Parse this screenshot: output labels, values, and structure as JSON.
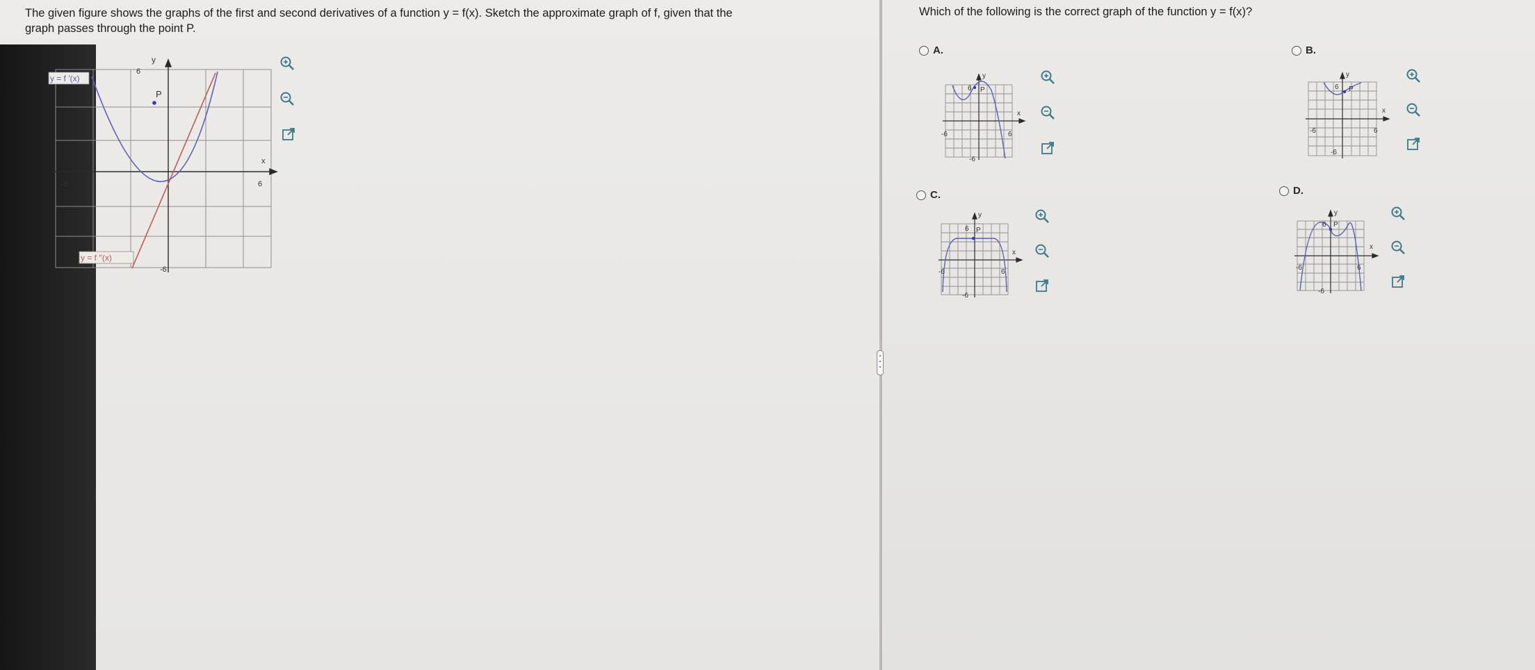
{
  "question": {
    "line1": "The given figure shows the graphs of the first and second derivatives of a function y = f(x). Sketch the approximate graph of f, given that the",
    "line2": "graph passes through the point P."
  },
  "prompt": "Which of the following is the correct graph of the function y = f(x)?",
  "main_graph": {
    "fprime_label": "y = f ′(x)",
    "fdoubleprime_label": "y = f ′′(x)",
    "point_label": "P",
    "x_label": "x",
    "y_label": "y",
    "tick_pos": "6",
    "tick_neg": "-6",
    "curve_color": "#5a5fb8",
    "line_color": "#c05a58"
  },
  "options": [
    {
      "label": "A.",
      "y_label": "y",
      "x_label": "x",
      "point_label": "P",
      "tick_pos": "6",
      "tick_neg": "-6"
    },
    {
      "label": "B.",
      "y_label": "y",
      "x_label": "x",
      "point_label": "P",
      "tick_pos": "6",
      "tick_neg": "-6"
    },
    {
      "label": "C.",
      "y_label": "y",
      "x_label": "x",
      "point_label": "P",
      "tick_pos": "6",
      "tick_neg": "-6"
    },
    {
      "label": "D.",
      "y_label": "y",
      "x_label": "x",
      "point_label": "P",
      "tick_pos": "6",
      "tick_neg": "-6"
    }
  ],
  "icons": [
    "zoom-in-icon",
    "zoom-out-icon",
    "popout-icon"
  ]
}
